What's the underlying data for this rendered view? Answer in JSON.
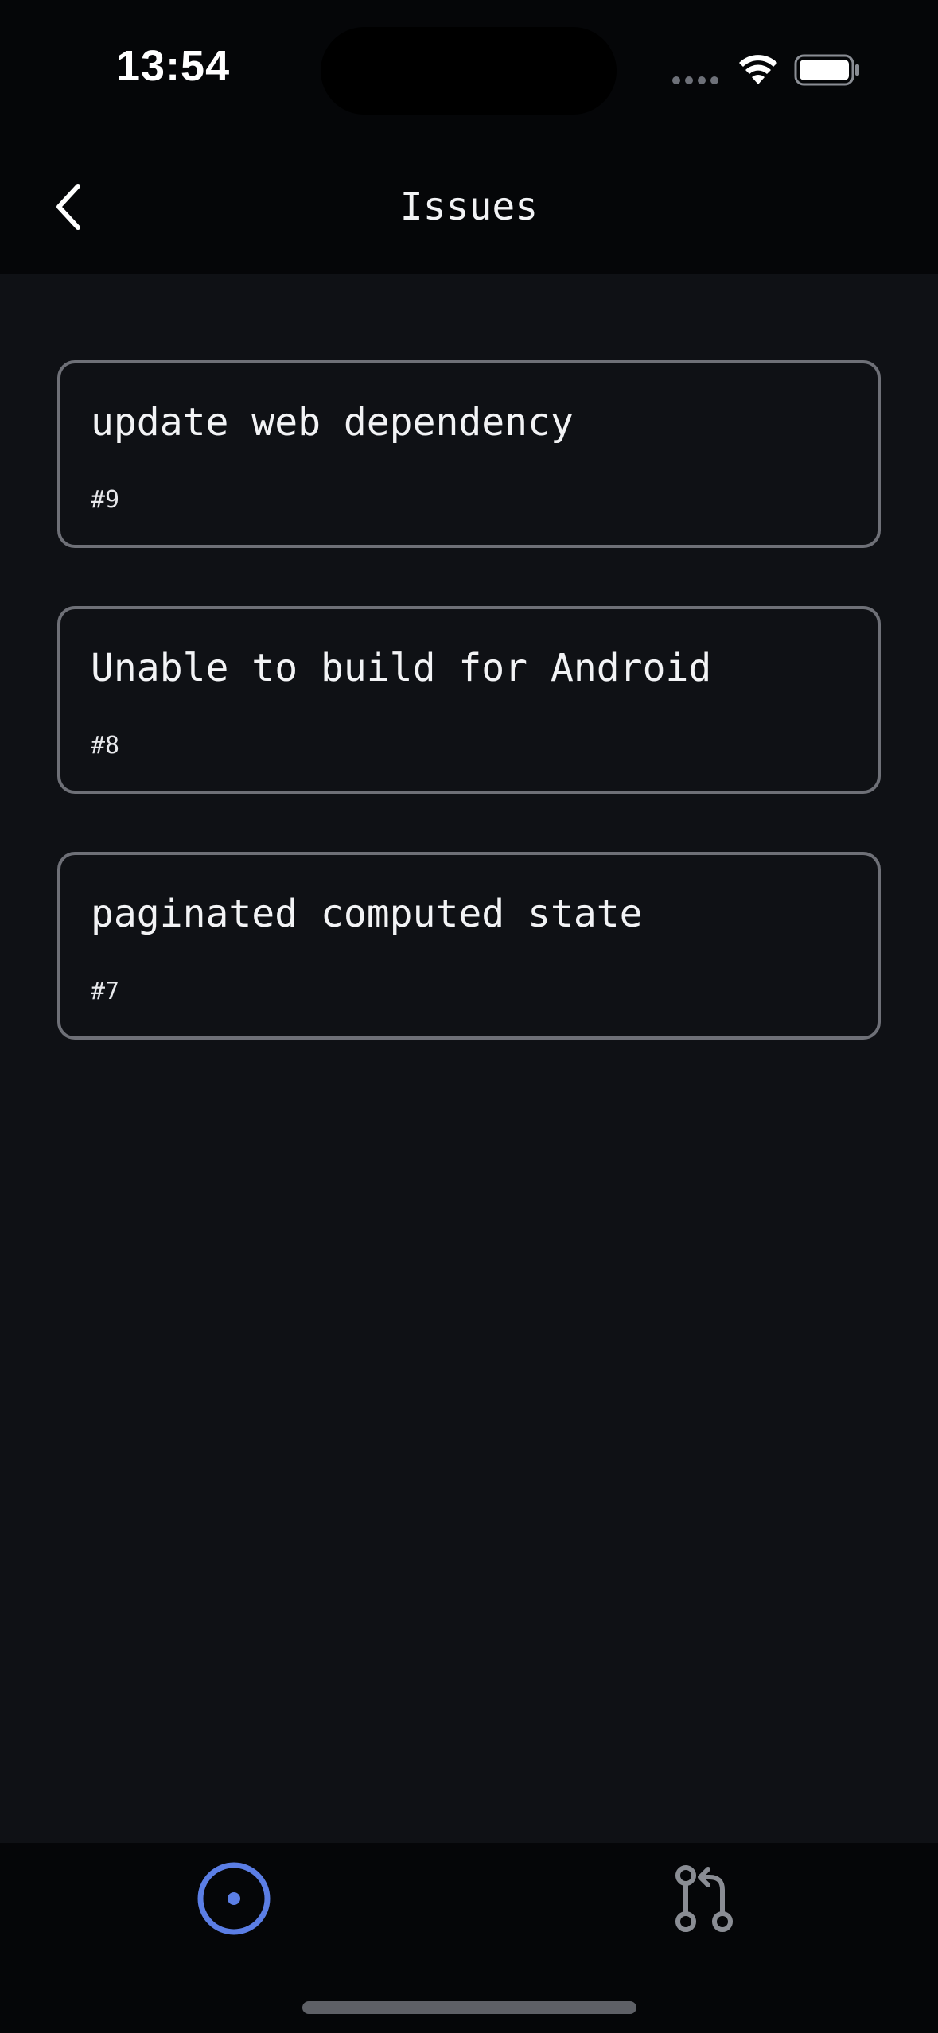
{
  "status_bar": {
    "time": "13:54"
  },
  "header": {
    "title": "Issues",
    "back_icon": "chevron-left-icon"
  },
  "issues": [
    {
      "title": "update web dependency",
      "number": "#9"
    },
    {
      "title": "Unable to build for Android",
      "number": "#8"
    },
    {
      "title": "paginated computed state",
      "number": "#7"
    }
  ],
  "tab_bar": {
    "tabs": [
      {
        "icon": "issue-opened-icon",
        "active": true
      },
      {
        "icon": "pull-request-icon",
        "active": false
      }
    ],
    "active_color": "#5b7ee5",
    "inactive_color": "#8a8d94"
  },
  "colors": {
    "background": "#0f1115",
    "bar_background": "#050608",
    "card_border": "#6e7077",
    "text": "#f2f3f5"
  }
}
